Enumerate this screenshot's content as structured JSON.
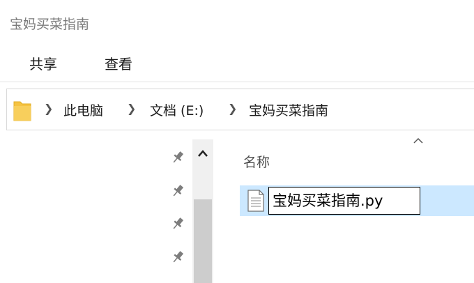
{
  "window": {
    "title": "宝妈买菜指南"
  },
  "ribbon": {
    "tabs": [
      {
        "label": "共享"
      },
      {
        "label": "查看"
      }
    ]
  },
  "address": {
    "crumbs": [
      "此电脑",
      "文档 (E:)",
      "宝妈买菜指南"
    ]
  },
  "columns": {
    "name": "名称"
  },
  "files": [
    {
      "name": "宝妈买菜指南.py",
      "selected": true,
      "renaming": true
    }
  ],
  "colors": {
    "selection": "#cce8ff",
    "folder": "#f5c342"
  },
  "icons": {
    "folder": "folder-icon",
    "breadcrumb_separator": "chevron-right-icon",
    "pin": "pin-icon",
    "scroll_up": "chevron-up-icon",
    "sort": "sort-ascending-icon",
    "file": "text-file-icon"
  }
}
